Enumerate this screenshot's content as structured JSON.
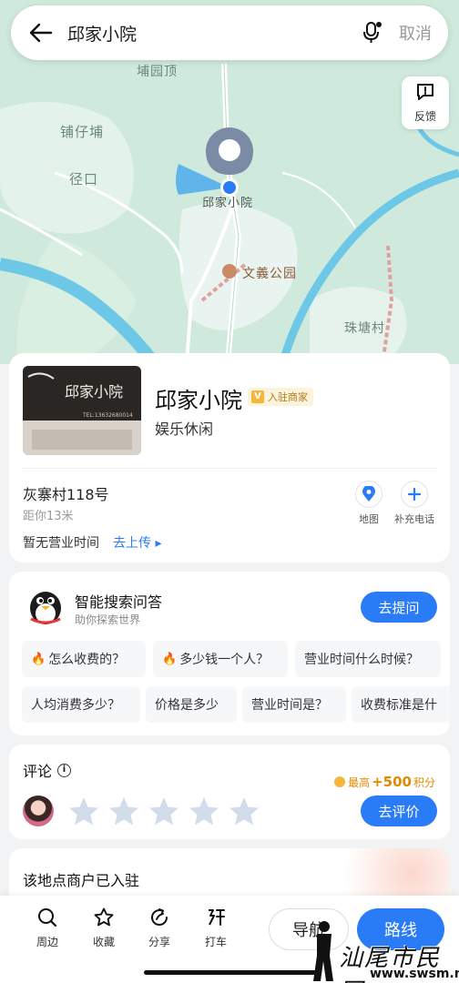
{
  "search": {
    "query": "邱家小院",
    "cancel_label": "取消"
  },
  "map": {
    "feedback_label": "反馈",
    "labels": {
      "puyuanding": "埔园顶",
      "puzaipu": "铺仔埔",
      "jingkou": "径口",
      "pin_label": "邱家小院",
      "park": "文義公园",
      "zhutangcun": "珠塘村"
    }
  },
  "poi": {
    "name": "邱家小院",
    "badge": "入驻商家",
    "badge_icon": "V",
    "category": "娱乐休闲",
    "address": "灰寨村118号",
    "distance": "距你13米",
    "hours_text": "暂无营业时间",
    "upload_label": "去上传 ▸",
    "actions": [
      {
        "label": "地图",
        "icon": "location-pin-icon"
      },
      {
        "label": "补充电话",
        "icon": "plus-icon"
      }
    ],
    "thumb": {
      "sign_text": "邱家小院",
      "sign_sub": "TEL:13632680014"
    }
  },
  "qa": {
    "title": "智能搜索问答",
    "subtitle": "助你探索世界",
    "ask_label": "去提问",
    "chips_row1": [
      "怎么收费的？",
      "多少钱一个人？",
      "营业时间什么时候？"
    ],
    "chips_row2": [
      "人均消费多少？",
      "价格是多少",
      "营业时间是？",
      "收费标准是什"
    ]
  },
  "review": {
    "title": "评论",
    "reward_prefix": "最高",
    "reward_amount": "+500",
    "reward_suffix": "积分",
    "button_label": "去评价",
    "star_count": 5
  },
  "merchant": {
    "title": "该地点商户已入驻"
  },
  "bottom_bar": {
    "tabs": [
      {
        "label": "周边",
        "icon": "search-icon"
      },
      {
        "label": "收藏",
        "icon": "star-icon"
      },
      {
        "label": "分享",
        "icon": "share-icon"
      },
      {
        "label": "打车",
        "icon": "taxi-icon"
      }
    ],
    "nav_label": "导航",
    "route_label": "路线"
  },
  "watermark": {
    "text": "汕尾市民网",
    "url": "www.swsm.net"
  },
  "colors": {
    "accent": "#2a7cf6",
    "map_bg": "#cfeadc",
    "water": "#6cc8e6",
    "reward": "#e08a00"
  }
}
